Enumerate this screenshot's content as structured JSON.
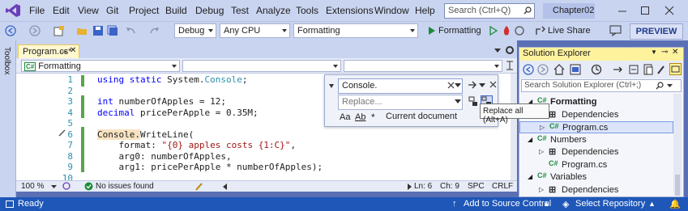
{
  "menu": [
    "File",
    "Edit",
    "View",
    "Git",
    "Project",
    "Build",
    "Debug",
    "Test",
    "Analyze",
    "Tools",
    "Extensions",
    "Window",
    "Help"
  ],
  "search": {
    "placeholder": "Search (Ctrl+Q)"
  },
  "solution_name": "Chapter02",
  "toolbar": {
    "configuration": "Debug",
    "platform": "Any CPU",
    "startup_project": "Formatting",
    "run_label": "Formatting",
    "live_share": "Live Share",
    "preview": "PREVIEW"
  },
  "toolbox_label": "Toolbox",
  "editor_tab": {
    "title": "Program.cs*"
  },
  "navbar": {
    "project": "Formatting"
  },
  "code_lines": [
    {
      "n": "1",
      "segs": [
        [
          "kw",
          "using static "
        ],
        [
          "",
          "System."
        ],
        [
          "ty",
          "Console"
        ],
        [
          "",
          ";"
        ]
      ]
    },
    {
      "n": "2",
      "segs": []
    },
    {
      "n": "3",
      "segs": [
        [
          "kw",
          "int "
        ],
        [
          "",
          "numberOfApples = 12;"
        ]
      ]
    },
    {
      "n": "4",
      "segs": [
        [
          "kw",
          "decimal "
        ],
        [
          "",
          "pricePerApple = 0.35M;"
        ]
      ]
    },
    {
      "n": "5",
      "segs": []
    },
    {
      "n": "6",
      "segs": [
        [
          "hl",
          "Console"
        ],
        [
          "hl",
          "."
        ],
        [
          "",
          "WriteLine("
        ]
      ]
    },
    {
      "n": "7",
      "segs": [
        [
          "",
          "    format: "
        ],
        [
          "st",
          "\"{0} apples costs {1:C}\""
        ],
        [
          "",
          ","
        ]
      ]
    },
    {
      "n": "8",
      "segs": [
        [
          "",
          "    arg0: numberOfApples,"
        ]
      ]
    },
    {
      "n": "9",
      "segs": [
        [
          "",
          "    arg1: pricePerApple * numberOfApples);"
        ]
      ]
    },
    {
      "n": "10",
      "segs": []
    }
  ],
  "find": {
    "find_value": "Console.",
    "replace_placeholder": "Replace...",
    "match_case": "Aa",
    "whole_word": "Ab",
    "scope": "Current document",
    "tooltip": "Replace all (Alt+A)"
  },
  "editor_status": {
    "zoom": "100 %",
    "issues": "No issues found",
    "ln": "Ln: 6",
    "ch": "Ch: 9",
    "spc": "SPC",
    "crlf": "CRLF"
  },
  "solution_explorer": {
    "title": "Solution Explorer",
    "search_placeholder": "Search Solution Explorer (Ctrl+;)",
    "items": [
      {
        "label": "Formatting",
        "bold": true,
        "icon": "C#",
        "caret": "down",
        "indent": 0
      },
      {
        "label": "Dependencies",
        "icon": "dep",
        "caret": "right",
        "indent": 1
      },
      {
        "label": "Program.cs",
        "icon": "C#",
        "caret": "right",
        "indent": 1,
        "selected": true
      },
      {
        "label": "Numbers",
        "icon": "C#",
        "caret": "down",
        "indent": 0
      },
      {
        "label": "Dependencies",
        "icon": "dep",
        "caret": "right",
        "indent": 1
      },
      {
        "label": "Program.cs",
        "icon": "C#",
        "caret": "none",
        "indent": 1
      },
      {
        "label": "Variables",
        "icon": "C#",
        "caret": "down",
        "indent": 0
      },
      {
        "label": "Dependencies",
        "icon": "dep",
        "caret": "right",
        "indent": 1
      }
    ]
  },
  "status_bar": {
    "ready": "Ready",
    "source_control": "Add to Source Control",
    "repository": "Select Repository"
  },
  "colors": {
    "accent": "#1e57b8",
    "title_bg": "#c9d4f0",
    "se_header": "#fff29d"
  }
}
